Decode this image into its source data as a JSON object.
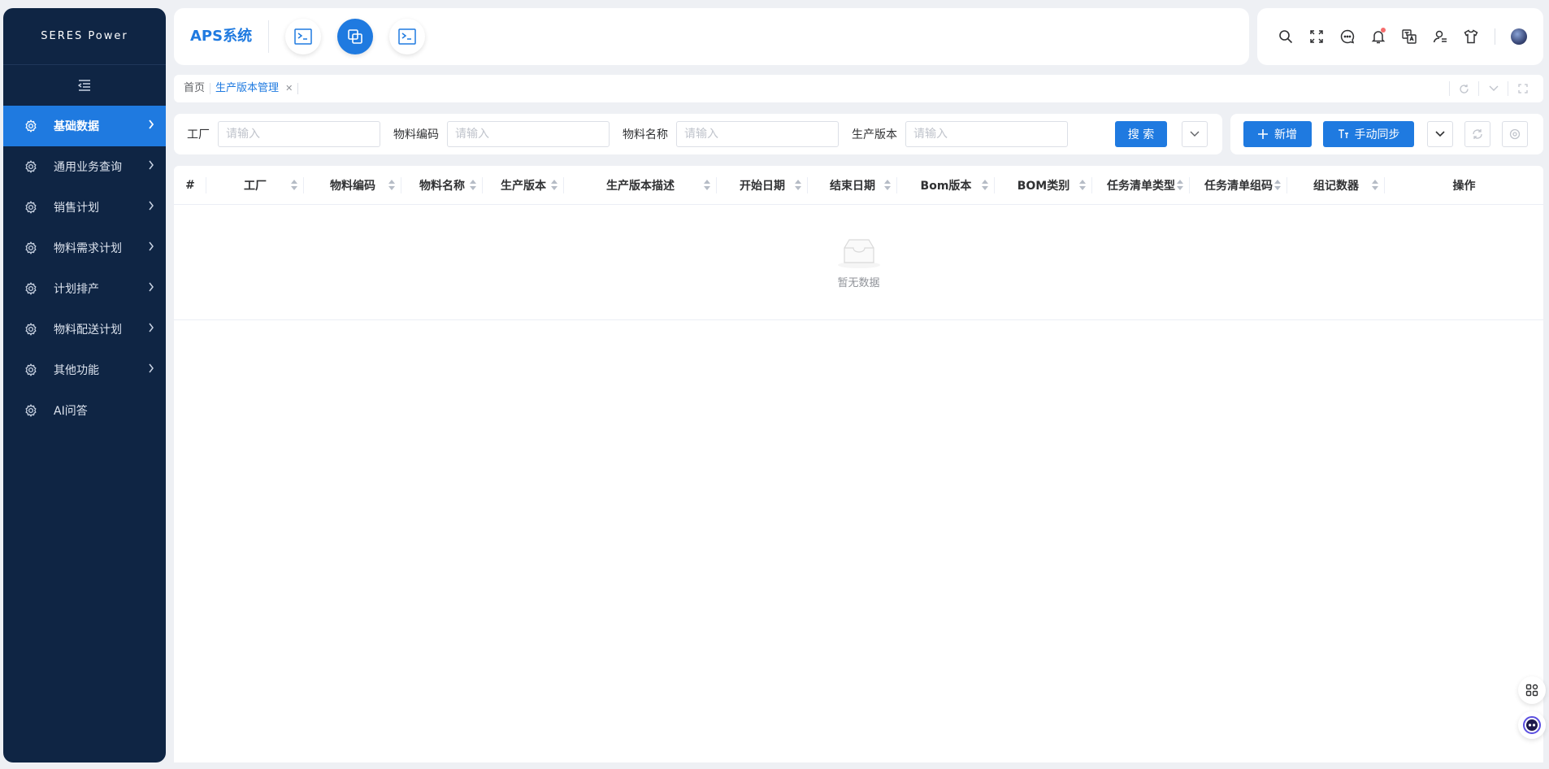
{
  "sidebar": {
    "logo": "SERES Power",
    "items": [
      {
        "label": "基础数据",
        "active": true
      },
      {
        "label": "通用业务查询"
      },
      {
        "label": "销售计划"
      },
      {
        "label": "物料需求计划"
      },
      {
        "label": "计划排产"
      },
      {
        "label": "物料配送计划"
      },
      {
        "label": "其他功能"
      },
      {
        "label": "AI问答"
      }
    ]
  },
  "header": {
    "brand": "APS系统",
    "nav_icons": [
      "terminal-icon",
      "copy-icon",
      "terminal-icon"
    ]
  },
  "toolbar": {
    "icons": [
      "search-icon",
      "fullscreen-icon",
      "message-icon",
      "bell-icon",
      "translate-icon",
      "user-icon",
      "shirt-icon"
    ]
  },
  "tabs": [
    {
      "label": "首页"
    },
    {
      "label": "生产版本管理",
      "active": true
    }
  ],
  "search": {
    "fields": [
      {
        "label": "工厂",
        "placeholder": "请输入"
      },
      {
        "label": "物料编码",
        "placeholder": "请输入"
      },
      {
        "label": "物料名称",
        "placeholder": "请输入"
      },
      {
        "label": "生产版本",
        "placeholder": "请输入"
      }
    ],
    "search_label": "搜 索"
  },
  "actions": {
    "add_label": "新增",
    "sync_label": "手动同步"
  },
  "table": {
    "columns": [
      "#",
      "工厂",
      "物料编码",
      "物料名称",
      "生产版本",
      "生产版本描述",
      "开始日期",
      "结束日期",
      "Bom版本",
      "BOM类别",
      "任务清单类型",
      "任务清单组码",
      "组记数器",
      "操作"
    ],
    "rows": [],
    "empty_text": "暂无数据"
  },
  "colors": {
    "primary": "#1f7ae0",
    "sidebar_bg": "#0f2544",
    "page_bg": "#eef0f4"
  }
}
